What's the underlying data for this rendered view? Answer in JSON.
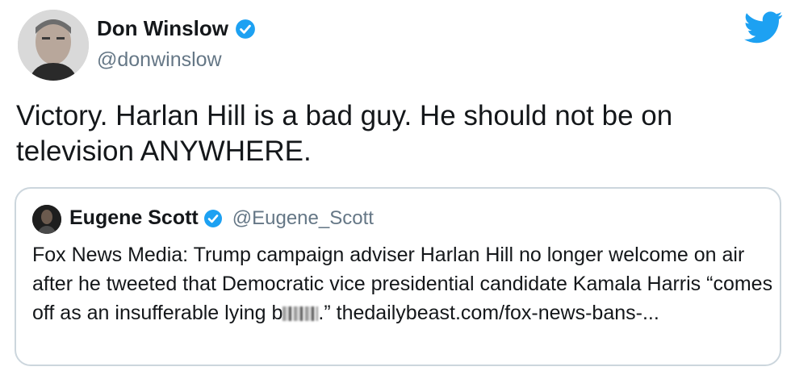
{
  "author": {
    "name": "Don Winslow",
    "handle": "@donwinslow"
  },
  "tweet": {
    "text": "Victory. Harlan Hill is a bad guy. He should not be on television ANYWHERE."
  },
  "quoted": {
    "name": "Eugene Scott",
    "handle": "@Eugene_Scott",
    "text_before": "Fox News Media: Trump campaign adviser Harlan Hill no longer welcome on air after he tweeted that Democratic vice presidential candidate Kamala Harris “comes off as an insufferable lying b",
    "text_after": ".” thedailybeast.com/fox-news-bans-..."
  },
  "colors": {
    "twitter_blue": "#1da1f2",
    "secondary_text": "#657786",
    "border": "#ccd6dd"
  },
  "icons": {
    "verified": "verified-badge-icon",
    "brand": "twitter-bird-icon"
  }
}
